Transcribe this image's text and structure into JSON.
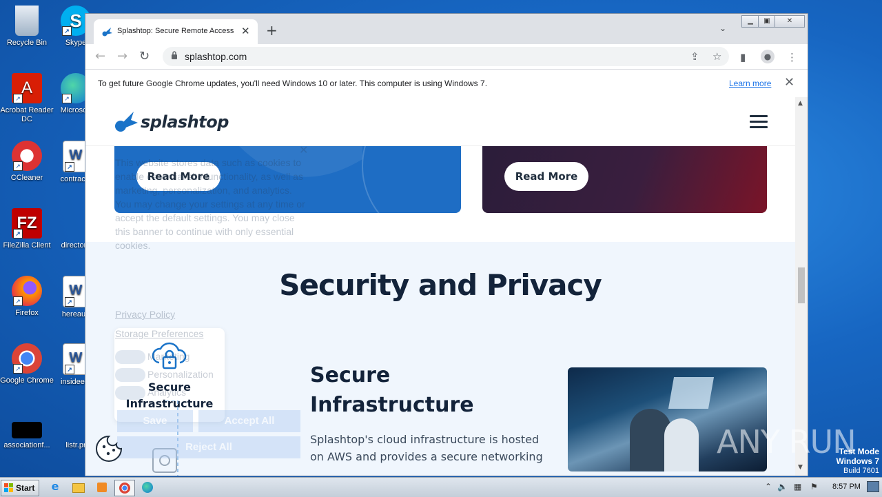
{
  "desktop": {
    "icons": [
      {
        "label": "Recycle Bin"
      },
      {
        "label": "Skype"
      },
      {
        "label": "Acrobat Reader DC"
      },
      {
        "label": "Microsoft"
      },
      {
        "label": "CCleaner"
      },
      {
        "label": "contractc"
      },
      {
        "label": "FileZilla Client"
      },
      {
        "label": "directorn"
      },
      {
        "label": "Firefox"
      },
      {
        "label": "hereaug"
      },
      {
        "label": "Google Chrome"
      },
      {
        "label": "insideent"
      },
      {
        "label": "associationf..."
      },
      {
        "label": "listr.pr"
      }
    ]
  },
  "browser": {
    "tab_title": "Splashtop: Secure Remote Access &",
    "url": "splashtop.com",
    "infobar_message": "To get future Google Chrome updates, you'll need Windows 10 or later. This computer is using Windows 7.",
    "infobar_link": "Learn more"
  },
  "page": {
    "logo_text": "splashtop",
    "read_more_1": "Read More",
    "read_more_2": "Read More",
    "section_title": "Security and Privacy",
    "feature_card_label": "Secure Infrastructure",
    "feature_title_line1": "Secure",
    "feature_title_line2": "Infrastructure",
    "feature_desc": "Splashtop's cloud infrastructure is hosted on AWS and provides a secure networking"
  },
  "cookie_banner": {
    "text": "This website stores data such as cookies to enable essential site functionality, as well as marketing, personalization, and analytics. You may change your settings at any time or accept the default settings. You may close this banner to continue with only essential cookies.",
    "privacy_policy": "Privacy Policy",
    "storage_preferences": "Storage Preferences",
    "toggle_marketing": "Marketing",
    "toggle_personalization": "Personalization",
    "toggle_analytics": "Analytics",
    "save": "Save",
    "accept_all": "Accept All",
    "reject_all": "Reject All"
  },
  "overlay": {
    "watermark": "ANY RUN",
    "test_mode": "Test Mode",
    "os": "Windows 7",
    "build": "Build 7601"
  },
  "taskbar": {
    "start_label": "Start",
    "clock": "8:57 PM"
  },
  "colors": {
    "brand_dark": "#13233a",
    "card_blue": "#1e6dc4",
    "section_bg": "#f0f6fd",
    "link_blue": "#1a73e8"
  }
}
